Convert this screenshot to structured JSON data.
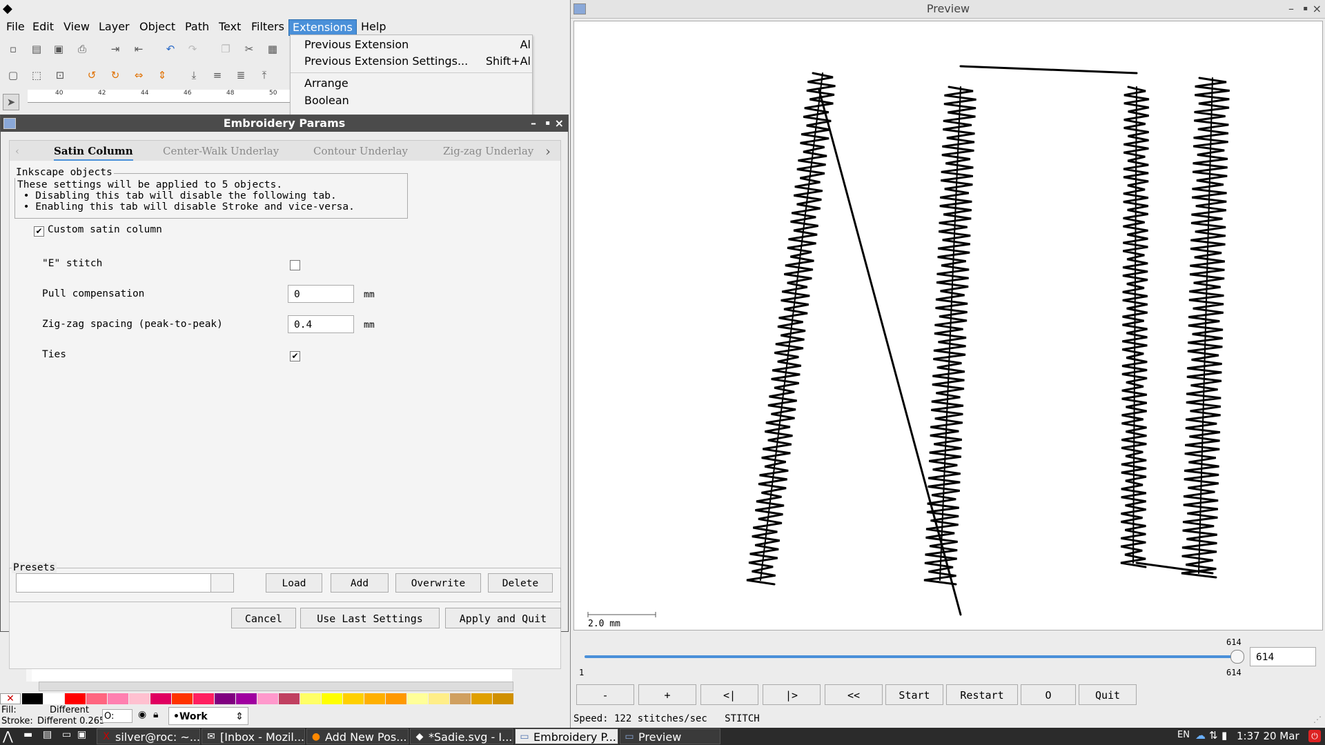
{
  "inkscape": {
    "menus": [
      "File",
      "Edit",
      "View",
      "Layer",
      "Object",
      "Path",
      "Text",
      "Filters",
      "Extensions",
      "Help"
    ],
    "ruler_ticks": [
      "40",
      "42",
      "44",
      "46",
      "48",
      "50"
    ],
    "extensions_menu": [
      {
        "label": "Previous Extension",
        "accel": "Al"
      },
      {
        "label": "Previous Extension Settings...",
        "accel": "Shift+Al"
      },
      {
        "label": "Arrange",
        "accel": ""
      },
      {
        "label": "Boolean",
        "accel": ""
      }
    ],
    "status": {
      "fill_label": "Fill:",
      "fill_value": "Different",
      "stroke_label": "Stroke:",
      "stroke_value": "Different 0.265",
      "opacity_label": "O:",
      "layer": "•Work"
    },
    "palette_colors": [
      "#000000",
      "#ffffff",
      "#ff0000",
      "#ff6680",
      "#ff80b0",
      "#ffc0d0",
      "#e00060",
      "#ff3300",
      "#ff2060",
      "#800080",
      "#a000a0",
      "#ff99cc",
      "#c04060",
      "#ffff66",
      "#ffff00",
      "#ffd000",
      "#ffb000",
      "#ff9900",
      "#ffff99",
      "#ffee88",
      "#d0a060",
      "#e0a000",
      "#d09000"
    ]
  },
  "dialog": {
    "title": "Embroidery Params",
    "tabs": [
      "Satin Column",
      "Center-Walk Underlay",
      "Contour Underlay",
      "Zig-zag Underlay"
    ],
    "active_tab": "Satin Column",
    "info_title": "Inkscape objects",
    "info_lines": [
      "These settings will be applied to 5 objects.",
      " • Disabling this tab will disable the following tab.",
      " • Enabling this tab will disable Stroke and vice-versa."
    ],
    "custom_checkbox": "Custom satin column",
    "fields": {
      "e_stitch_label": "\"E\" stitch",
      "pull_label": "Pull compensation",
      "pull_value": "0",
      "pull_unit": "mm",
      "zigzag_label": "Zig-zag spacing (peak-to-peak)",
      "zigzag_value": "0.4",
      "zigzag_unit": "mm",
      "ties_label": "Ties"
    },
    "presets_title": "Presets",
    "preset_buttons": {
      "load": "Load",
      "add": "Add",
      "overwrite": "Overwrite",
      "delete": "Delete"
    },
    "bottom_buttons": {
      "cancel": "Cancel",
      "use_last": "Use Last Settings",
      "apply": "Apply and Quit"
    }
  },
  "preview": {
    "title": "Preview",
    "scale_label": "2.0 mm",
    "slider": {
      "min_label": "1",
      "max_label_top": "614",
      "max_label_bottom": "614",
      "value": "614"
    },
    "buttons": [
      "-",
      "+",
      "<|",
      "|>",
      "<<",
      "Start",
      "Restart",
      "O",
      "Quit"
    ],
    "status": "Speed: 122 stitches/sec   STITCH"
  },
  "taskbar": {
    "items": [
      {
        "label": "silver@roc: ~...",
        "icon": "terminal-icon"
      },
      {
        "label": "[Inbox - Mozil...",
        "icon": "mail-icon"
      },
      {
        "label": "Add New Pos...",
        "icon": "firefox-icon"
      },
      {
        "label": "*Sadie.svg - I...",
        "icon": "inkscape-icon"
      },
      {
        "label": "Embroidery P...",
        "icon": "window-icon"
      },
      {
        "label": "Preview",
        "icon": "window-icon"
      }
    ],
    "lang": "EN",
    "clock": "1:37 20 Mar"
  }
}
